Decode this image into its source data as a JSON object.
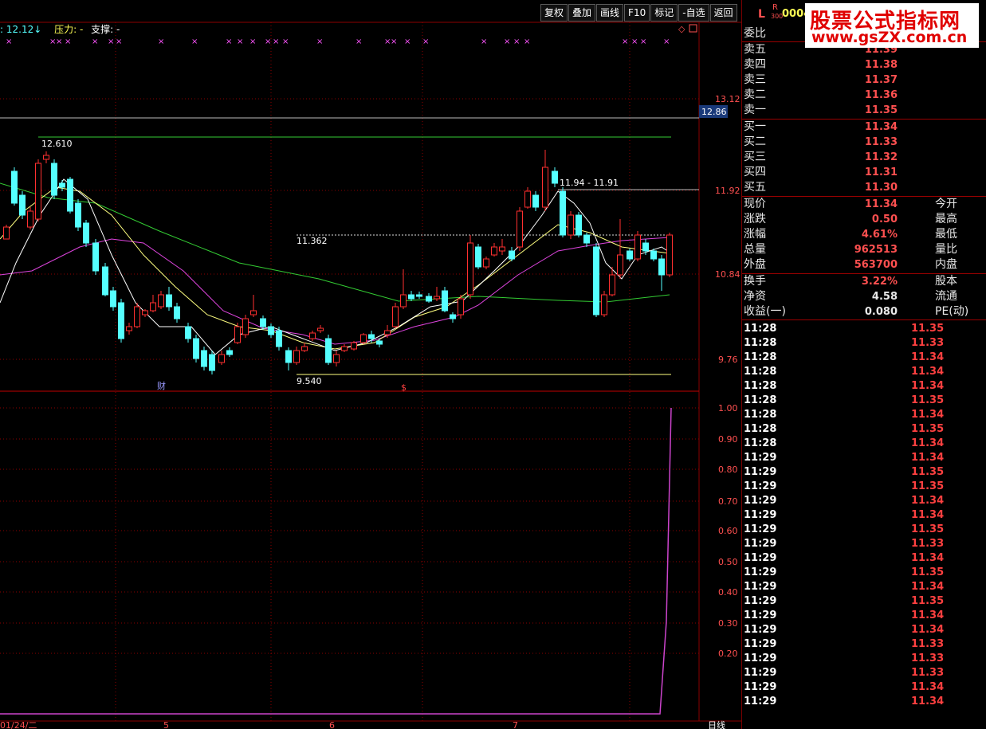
{
  "toolbar": [
    "复权",
    "叠加",
    "画线",
    "F10",
    "标记",
    "-自选",
    "返回"
  ],
  "info": {
    "price": "12.12↓",
    "pressure": "压力: -",
    "support": "支撑: -"
  },
  "header": {
    "l": "L",
    "r": "R",
    "r_sub": "300",
    "code": "0004"
  },
  "price_axis": {
    "t1": "13.12",
    "t2": "11.92",
    "t3": "10.84",
    "t4": "9.76",
    "current": "12.86"
  },
  "ind_axis": [
    "1.00",
    "0.90",
    "0.80",
    "0.70",
    "0.60",
    "0.50",
    "0.40",
    "0.30",
    "0.20"
  ],
  "annotations": {
    "high": "12.610",
    "low": "9.540",
    "mid": "11.362",
    "range": "11.94 - 11.91",
    "cai": "财",
    "dollar": "$",
    "diamond": "◇"
  },
  "dates": {
    "d1": "01/24/二",
    "d2": "5",
    "d3": "6",
    "d4": "7",
    "period": "日线"
  },
  "colors": {
    "bg": "#000000",
    "up": "#ff3030",
    "down": "#55ffff",
    "ma_white": "#ffffff",
    "ma_yellow": "#ffff80",
    "ma_magenta": "#dd44dd",
    "ma_green": "#33cc33",
    "grid": "#8b0000"
  },
  "side": {
    "weibi": "委比",
    "asks": [
      {
        "l": "卖五",
        "v": "11.39"
      },
      {
        "l": "卖四",
        "v": "11.38"
      },
      {
        "l": "卖三",
        "v": "11.37"
      },
      {
        "l": "卖二",
        "v": "11.36"
      },
      {
        "l": "卖一",
        "v": "11.35"
      }
    ],
    "bids": [
      {
        "l": "买一",
        "v": "11.34"
      },
      {
        "l": "买二",
        "v": "11.33"
      },
      {
        "l": "买三",
        "v": "11.32"
      },
      {
        "l": "买四",
        "v": "11.31"
      },
      {
        "l": "买五",
        "v": "11.30"
      }
    ],
    "stats": [
      {
        "l": "现价",
        "v": "11.34",
        "l2": "今开"
      },
      {
        "l": "涨跌",
        "v": "0.50",
        "l2": "最高"
      },
      {
        "l": "涨幅",
        "v": "4.61%",
        "l2": "最低"
      },
      {
        "l": "总量",
        "v": "962513",
        "l2": "量比"
      },
      {
        "l": "外盘",
        "v": "563700",
        "l2": "内盘"
      }
    ],
    "stats2": [
      {
        "l": "换手",
        "v": "3.22%",
        "l2": "股本"
      },
      {
        "l": "净资",
        "v": "4.58",
        "l2": "流通"
      },
      {
        "l": "收益(一)",
        "v": "0.080",
        "l2": "PE(动)"
      }
    ],
    "ticks": [
      {
        "t": "11:28",
        "p": "11.35"
      },
      {
        "t": "11:28",
        "p": "11.33"
      },
      {
        "t": "11:28",
        "p": "11.34"
      },
      {
        "t": "11:28",
        "p": "11.34"
      },
      {
        "t": "11:28",
        "p": "11.34"
      },
      {
        "t": "11:28",
        "p": "11.35"
      },
      {
        "t": "11:28",
        "p": "11.34"
      },
      {
        "t": "11:28",
        "p": "11.35"
      },
      {
        "t": "11:28",
        "p": "11.34"
      },
      {
        "t": "11:29",
        "p": "11.34"
      },
      {
        "t": "11:29",
        "p": "11.35"
      },
      {
        "t": "11:29",
        "p": "11.35"
      },
      {
        "t": "11:29",
        "p": "11.34"
      },
      {
        "t": "11:29",
        "p": "11.34"
      },
      {
        "t": "11:29",
        "p": "11.35"
      },
      {
        "t": "11:29",
        "p": "11.33"
      },
      {
        "t": "11:29",
        "p": "11.34"
      },
      {
        "t": "11:29",
        "p": "11.35"
      },
      {
        "t": "11:29",
        "p": "11.34"
      },
      {
        "t": "11:29",
        "p": "11.35"
      },
      {
        "t": "11:29",
        "p": "11.34"
      },
      {
        "t": "11:29",
        "p": "11.34"
      },
      {
        "t": "11:29",
        "p": "11.33"
      },
      {
        "t": "11:29",
        "p": "11.33"
      },
      {
        "t": "11:29",
        "p": "11.33"
      },
      {
        "t": "11:29",
        "p": "11.34"
      },
      {
        "t": "11:29",
        "p": "11.34"
      }
    ]
  },
  "watermark": {
    "line1": "股票公式指标网",
    "line2": "www.gsZX.com.cn"
  }
}
